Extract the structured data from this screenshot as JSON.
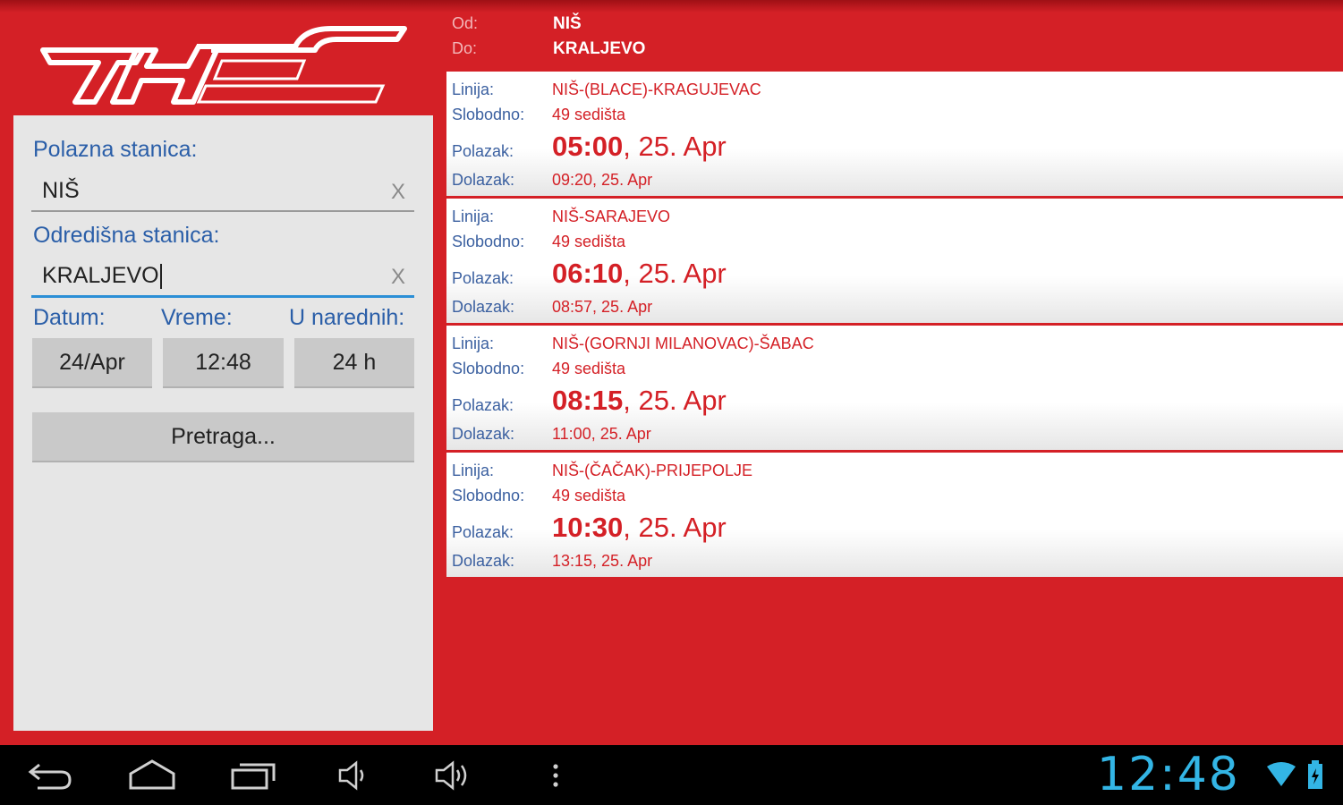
{
  "header": {
    "from_label": "Od:",
    "from_value": "NIŠ",
    "to_label": "Do:",
    "to_value": "KRALJEVO"
  },
  "search": {
    "departure_label": "Polazna stanica:",
    "departure_value": "NIŠ",
    "destination_label": "Odredišna stanica:",
    "destination_value": "KRALJEVO",
    "clear_glyph": "X",
    "date_label": "Datum:",
    "time_label": "Vreme:",
    "range_label": "U narednih:",
    "date_value": "24/Apr",
    "time_value": "12:48",
    "range_value": "24 h",
    "search_button": "Pretraga..."
  },
  "result_labels": {
    "line": "Linija:",
    "free": "Slobodno:",
    "departure": "Polazak:",
    "arrival": "Dolazak:"
  },
  "results": [
    {
      "line": "NIŠ-(BLACE)-KRAGUJEVAC",
      "free": "49 sedišta",
      "dep_time": "05:00",
      "dep_date": ", 25. Apr",
      "arrival": "09:20, 25. Apr"
    },
    {
      "line": "NIŠ-SARAJEVO",
      "free": "49 sedišta",
      "dep_time": "06:10",
      "dep_date": ", 25. Apr",
      "arrival": "08:57, 25. Apr"
    },
    {
      "line": "NIŠ-(GORNJI MILANOVAC)-ŠABAC",
      "free": "49 sedišta",
      "dep_time": "08:15",
      "dep_date": ", 25. Apr",
      "arrival": "11:00, 25. Apr"
    },
    {
      "line": "NIŠ-(ČAČAK)-PRIJEPOLJE",
      "free": "49 sedišta",
      "dep_time": "10:30",
      "dep_date": ", 25. Apr",
      "arrival": "13:15, 25. Apr"
    }
  ],
  "statusbar": {
    "clock": "12:48",
    "icons": [
      "back-icon",
      "home-icon",
      "recent-apps-icon",
      "volume-down-icon",
      "volume-up-icon",
      "menu-icon",
      "wifi-icon",
      "battery-icon"
    ],
    "accent_color": "#33b5e5"
  },
  "colors": {
    "brand_red": "#d42026",
    "panel_gray": "#e6e6e6",
    "label_blue": "#2a5ea8"
  }
}
